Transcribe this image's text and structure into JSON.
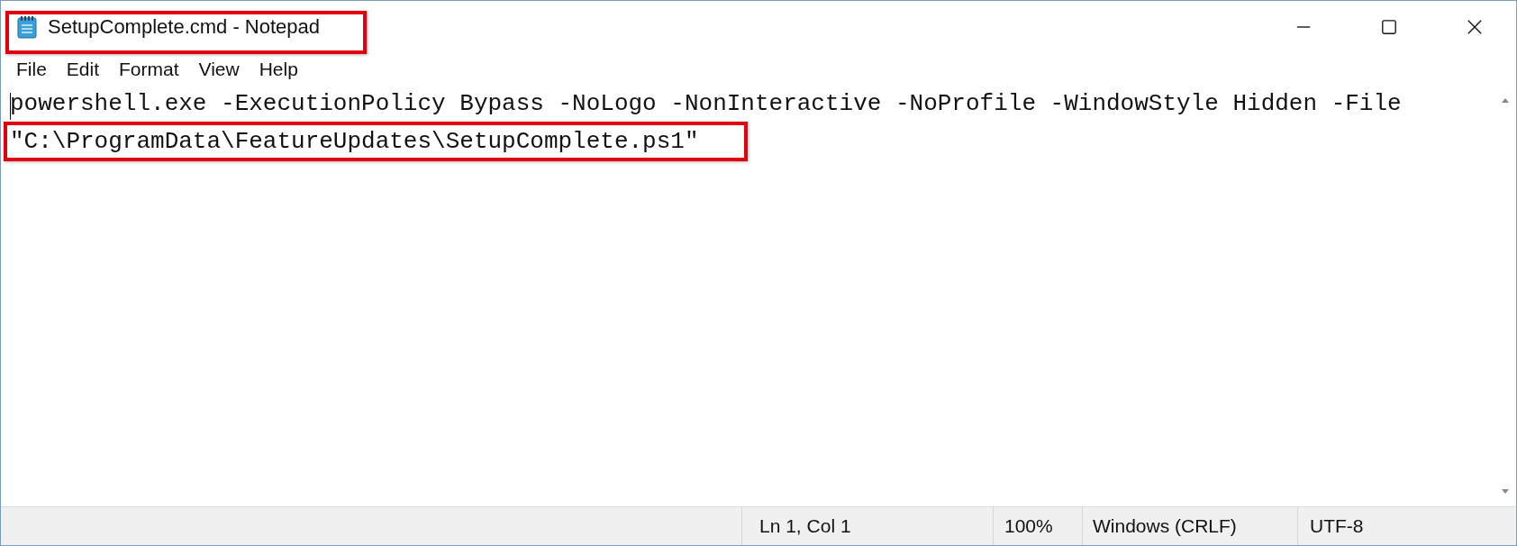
{
  "window": {
    "title": "SetupComplete.cmd - Notepad"
  },
  "menu": [
    "File",
    "Edit",
    "Format",
    "View",
    "Help"
  ],
  "editor": {
    "lines": [
      {
        "text": "powershell.exe -ExecutionPolicy Bypass -NoLogo -NonInteractive -NoProfile -WindowStyle Hidden -File",
        "highlighted": false
      },
      {
        "text": "\"C:\\ProgramData\\FeatureUpdates\\SetupComplete.ps1\"",
        "highlighted": true
      }
    ]
  },
  "status_bar": [
    "Ln 1, Col 1",
    "100%",
    "Windows (CRLF)",
    "UTF-8"
  ]
}
